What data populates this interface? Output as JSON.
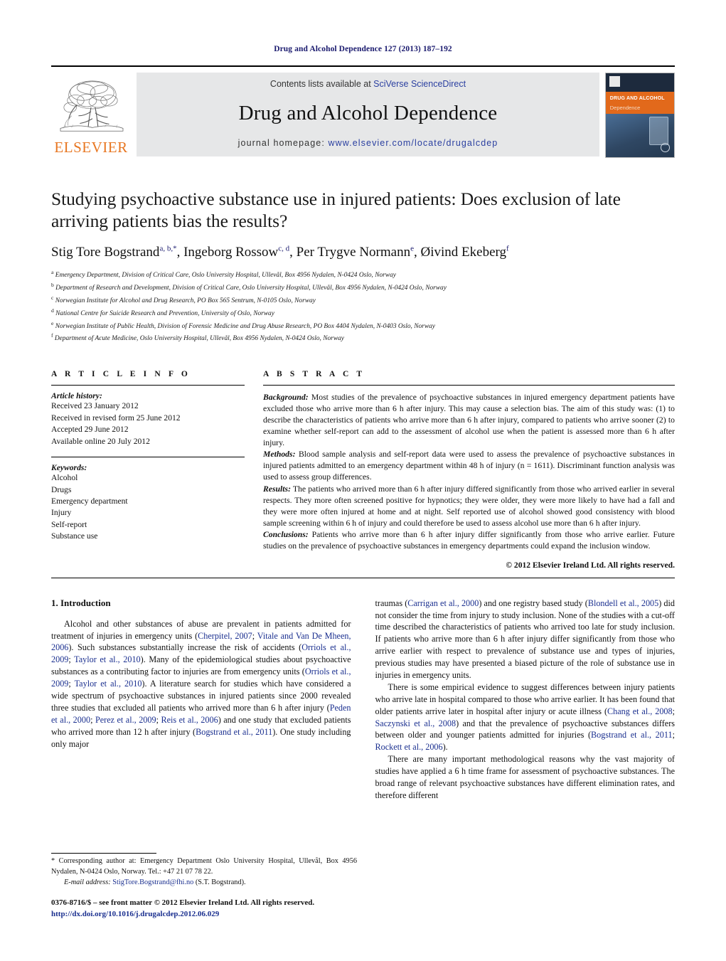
{
  "running_head": "Drug and Alcohol Dependence 127 (2013) 187–192",
  "masthead": {
    "publisher_name": "ELSEVIER",
    "contents_prefix": "Contents lists available at ",
    "contents_link": "SciVerse ScienceDirect",
    "journal_name": "Drug and Alcohol Dependence",
    "homepage_prefix": "journal homepage: ",
    "homepage_url": "www.elsevier.com/locate/drugalcdep",
    "cover": {
      "title_line1": "DRUG AND ALCOHOL",
      "title_line2": "Dependence"
    },
    "colors": {
      "elsevier_orange": "#E87722",
      "link_blue": "#2a3fa0",
      "banner_gray": "#e6e7e8"
    }
  },
  "article": {
    "title": "Studying psychoactive substance use in injured patients: Does exclusion of late arriving patients bias the results?",
    "authors_html": "Stig Tore Bogstrand<sup>a, b,</sup><sup>*</sup>, Ingeborg Rossow<sup>c, d</sup>, Per Trygve Normann<sup>e</sup>, Øivind Ekeberg<sup>f</sup>",
    "affiliations": [
      {
        "mark": "a",
        "text": "Emergency Department, Division of Critical Care, Oslo University Hospital, Ullevål, Box 4956 Nydalen, N-0424 Oslo, Norway"
      },
      {
        "mark": "b",
        "text": "Department of Research and Development, Division of Critical Care, Oslo University Hospital, Ullevål, Box 4956 Nydalen, N-0424 Oslo, Norway"
      },
      {
        "mark": "c",
        "text": "Norwegian Institute for Alcohol and Drug Research, PO Box 565 Sentrum, N-0105 Oslo, Norway"
      },
      {
        "mark": "d",
        "text": "National Centre for Suicide Research and Prevention, University of Oslo, Norway"
      },
      {
        "mark": "e",
        "text": "Norwegian Institute of Public Health, Division of Forensic Medicine and Drug Abuse Research, PO Box 4404 Nydalen, N-0403 Oslo, Norway"
      },
      {
        "mark": "f",
        "text": "Department of Acute Medicine, Oslo University Hospital, Ullevål, Box 4956 Nydalen, N-0424 Oslo, Norway"
      }
    ]
  },
  "article_info": {
    "heading": "A R T I C L E   I N F O",
    "history_label": "Article history:",
    "history": [
      "Received 23 January 2012",
      "Received in revised form 25 June 2012",
      "Accepted 29 June 2012",
      "Available online 20 July 2012"
    ],
    "keywords_label": "Keywords:",
    "keywords": [
      "Alcohol",
      "Drugs",
      "Emergency department",
      "Injury",
      "Self-report",
      "Substance use"
    ]
  },
  "abstract": {
    "heading": "A B S T R A C T",
    "paragraphs": [
      {
        "label": "Background:",
        "text": " Most studies of the prevalence of psychoactive substances in injured emergency department patients have excluded those who arrive more than 6 h after injury. This may cause a selection bias. The aim of this study was: (1) to describe the characteristics of patients who arrive more than 6 h after injury, compared to patients who arrive sooner (2) to examine whether self-report can add to the assessment of alcohol use when the patient is assessed more than 6 h after injury."
      },
      {
        "label": "Methods:",
        "text": " Blood sample analysis and self-report data were used to assess the prevalence of psychoactive substances in injured patients admitted to an emergency department within 48 h of injury (n = 1611). Discriminant function analysis was used to assess group differences."
      },
      {
        "label": "Results:",
        "text": " The patients who arrived more than 6 h after injury differed significantly from those who arrived earlier in several respects. They more often screened positive for hypnotics; they were older, they were more likely to have had a fall and they were more often injured at home and at night. Self reported use of alcohol showed good consistency with blood sample screening within 6 h of injury and could therefore be used to assess alcohol use more than 6 h after injury."
      },
      {
        "label": "Conclusions:",
        "text": " Patients who arrive more than 6 h after injury differ significantly from those who arrive earlier. Future studies on the prevalence of psychoactive substances in emergency departments could expand the inclusion window."
      }
    ],
    "copyright": "© 2012 Elsevier Ireland Ltd. All rights reserved."
  },
  "introduction": {
    "section_number_title": "1.  Introduction",
    "left_paragraphs": [
      "Alcohol and other substances of abuse are prevalent in patients admitted for treatment of injuries in emergency units (Cherpitel, 2007; Vitale and Van De Mheen, 2006). Such substances substantially increase the risk of accidents (Orriols et al., 2009; Taylor et al., 2010). Many of the epidemiological studies about psychoactive substances as a contributing factor to injuries are from emergency units (Orriols et al., 2009; Taylor et al., 2010). A literature search for studies which have considered a wide spectrum of psychoactive substances in injured patients since 2000 revealed three studies that excluded all patients who arrived more than 6 h after injury (Peden et al., 2000; Perez et al., 2009; Reis et al., 2006) and one study that excluded patients who arrived more than 12 h after injury (Bogstrand et al., 2011). One study including only major"
    ],
    "right_paragraphs": [
      "traumas (Carrigan et al., 2000) and one registry based study (Blondell et al., 2005) did not consider the time from injury to study inclusion. None of the studies with a cut-off time described the characteristics of patients who arrived too late for study inclusion. If patients who arrive more than 6 h after injury differ significantly from those who arrive earlier with respect to prevalence of substance use and types of injuries, previous studies may have presented a biased picture of the role of substance use in injuries in emergency units.",
      "There is some empirical evidence to suggest differences between injury patients who arrive late in hospital compared to those who arrive earlier. It has been found that older patients arrive later in hospital after injury or acute illness (Chang et al., 2008; Saczynski et al., 2008) and that the prevalence of psychoactive substances differs between older and younger patients admitted for injuries (Bogstrand et al., 2011; Rockett et al., 2006).",
      "There are many important methodological reasons why the vast majority of studies have applied a 6 h time frame for assessment of psychoactive substances. The broad range of relevant psychoactive substances have different elimination rates, and therefore different"
    ]
  },
  "footnotes": {
    "corresponding": "* Corresponding author at: Emergency Department Oslo University Hospital, Ullevål, Box 4956 Nydalen, N-0424 Oslo, Norway. Tel.: +47 21 07 78 22.",
    "email_label": "E-mail address:",
    "email": "StigTore.Bogstrand@fhi.no",
    "email_suffix": " (S.T. Bogstrand).",
    "issn_line": "0376-8716/$ – see front matter © 2012 Elsevier Ireland Ltd. All rights reserved.",
    "doi": "http://dx.doi.org/10.1016/j.drugalcdep.2012.06.029"
  }
}
